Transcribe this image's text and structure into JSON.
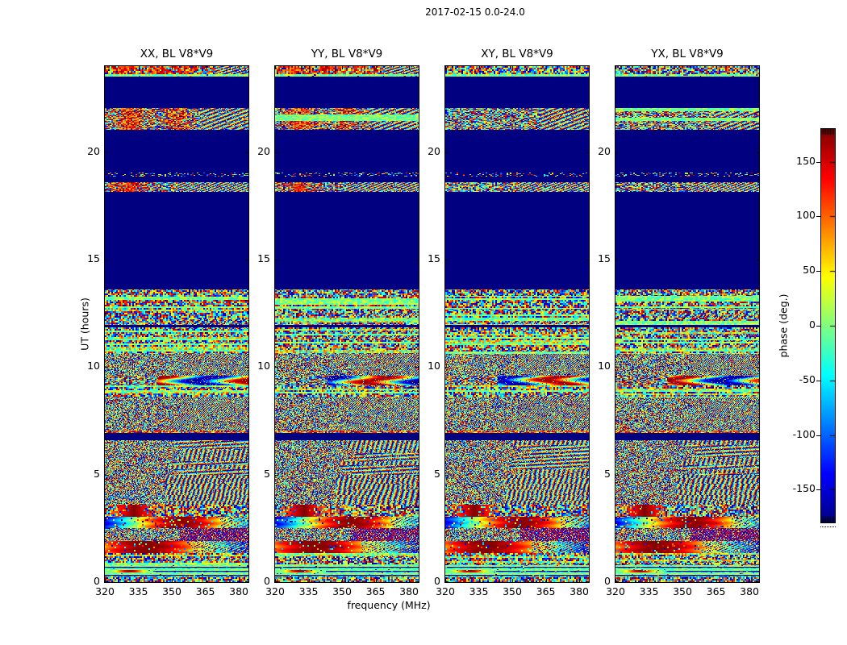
{
  "figure": {
    "title": "2017-02-15 0.0-24.0",
    "xlabel": "frequency (MHz)",
    "ylabel": "UT (hours)",
    "colorbar_label": "phase (deg.)",
    "background": "#ffffff",
    "solid_region_color": "#000080"
  },
  "chart_data": {
    "type": "heatmap",
    "subtype": "phase waterfall, 4 polarization panels",
    "title": "2017-02-15 0.0-24.0",
    "xlabel": "frequency (MHz)",
    "ylabel": "UT (hours)",
    "panels": [
      {
        "title": "XX, BL V8*V9",
        "seed": 11,
        "warm": true
      },
      {
        "title": "YY, BL V8*V9",
        "seed": 23,
        "warm": true
      },
      {
        "title": "XY, BL V8*V9",
        "seed": 37,
        "warm": false
      },
      {
        "title": "YX, BL V8*V9",
        "seed": 49,
        "warm": false
      }
    ],
    "x_range": [
      320,
      384.3
    ],
    "x_ticks": [
      320,
      335,
      350,
      365,
      380
    ],
    "y_range": [
      0,
      24
    ],
    "y_ticks": [
      0,
      5,
      10,
      15,
      20
    ],
    "colorbar": {
      "label": "phase (deg.)",
      "colormap": "jet",
      "range": [
        -180,
        180
      ],
      "tick_values": [
        150,
        100,
        50,
        0,
        -50,
        -100,
        -150
      ],
      "tick_labels": [
        "150",
        "100",
        "50",
        "0",
        "-50",
        "-100",
        "-150"
      ]
    },
    "bands": [
      {
        "from": 24.0,
        "to": 23.62,
        "type": "noise_top"
      },
      {
        "from": 23.62,
        "to": 23.5,
        "type": "pale"
      },
      {
        "from": 23.5,
        "to": 22.05,
        "type": "blue"
      },
      {
        "from": 22.05,
        "to": 21.05,
        "type": "band21"
      },
      {
        "from": 21.05,
        "to": 19.05,
        "type": "blue"
      },
      {
        "from": 19.05,
        "to": 18.85,
        "type": "sparse"
      },
      {
        "from": 18.85,
        "to": 18.6,
        "type": "blue"
      },
      {
        "from": 18.6,
        "to": 18.15,
        "type": "band18"
      },
      {
        "from": 18.15,
        "to": 13.62,
        "type": "blue"
      },
      {
        "from": 13.62,
        "to": 13.3,
        "type": "dense"
      },
      {
        "from": 13.3,
        "to": 12.7,
        "type": "mixed_pale"
      },
      {
        "from": 12.7,
        "to": 11.95,
        "type": "noise_rows"
      },
      {
        "from": 11.95,
        "to": 11.85,
        "type": "blue"
      },
      {
        "from": 11.85,
        "to": 10.6,
        "type": "noise_rows"
      },
      {
        "from": 10.6,
        "to": 9.6,
        "type": "chaos_moire"
      },
      {
        "from": 9.6,
        "to": 9.15,
        "type": "swirl"
      },
      {
        "from": 9.15,
        "to": 8.6,
        "type": "noise_rows"
      },
      {
        "from": 8.6,
        "to": 7.05,
        "type": "chaos_moire"
      },
      {
        "from": 7.05,
        "to": 6.95,
        "type": "warm_row"
      },
      {
        "from": 6.95,
        "to": 6.6,
        "type": "blue"
      },
      {
        "from": 6.6,
        "to": 5.0,
        "type": "chaos_moire2"
      },
      {
        "from": 5.0,
        "to": 3.6,
        "type": "chaos_vstripe"
      },
      {
        "from": 3.6,
        "to": 3.05,
        "type": "warm_blob"
      },
      {
        "from": 3.05,
        "to": 2.5,
        "type": "smooth_sweep"
      },
      {
        "from": 2.5,
        "to": 1.9,
        "type": "chaos_checker"
      },
      {
        "from": 1.9,
        "to": 1.35,
        "type": "smooth_sweep2"
      },
      {
        "from": 1.35,
        "to": 0.8,
        "type": "noise_rows"
      },
      {
        "from": 0.8,
        "to": 0.28,
        "type": "pale_lines"
      },
      {
        "from": 0.28,
        "to": 0.0,
        "type": "dense"
      }
    ]
  }
}
